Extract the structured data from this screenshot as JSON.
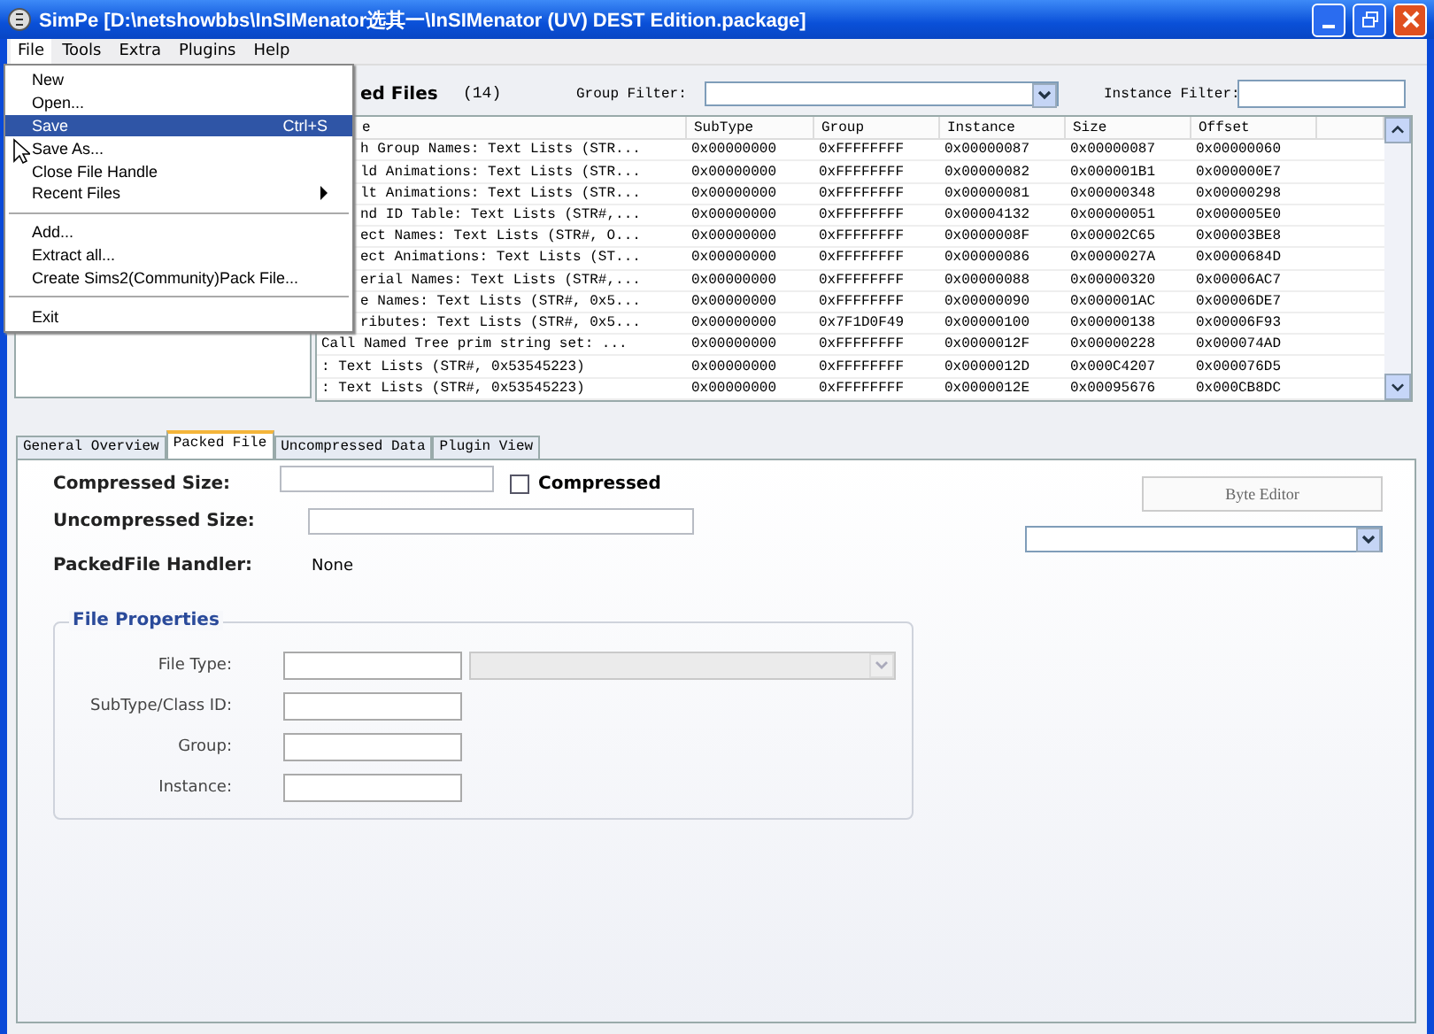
{
  "window": {
    "title": "SimPe [D:\\netshowbbs\\InSIMenator选其一\\InSIMenator (UV) DEST Edition.package]"
  },
  "menubar": [
    {
      "label": "File",
      "selected": true
    },
    {
      "label": "Tools",
      "selected": false
    },
    {
      "label": "Extra",
      "selected": false
    },
    {
      "label": "Plugins",
      "selected": false
    },
    {
      "label": "Help",
      "selected": false
    }
  ],
  "file_menu": [
    {
      "kind": "item",
      "label": "New",
      "selected": false
    },
    {
      "kind": "item",
      "label": "Open...",
      "selected": false
    },
    {
      "kind": "item",
      "label": "Save",
      "shortcut": "Ctrl+S",
      "selected": true
    },
    {
      "kind": "item",
      "label": "Save As...",
      "selected": false
    },
    {
      "kind": "item",
      "label": "Close File Handle",
      "selected": false
    },
    {
      "kind": "submenu",
      "label": "Recent Files",
      "selected": false
    },
    {
      "kind": "separator"
    },
    {
      "kind": "item",
      "label": "Add...",
      "selected": false
    },
    {
      "kind": "item",
      "label": "Extract all...",
      "selected": false
    },
    {
      "kind": "item",
      "label": "Create Sims2(Community)Pack File...",
      "selected": false
    },
    {
      "kind": "separator"
    },
    {
      "kind": "item",
      "label": "Exit",
      "selected": false
    }
  ],
  "files_panel": {
    "title": "ed Files",
    "count": "(14)",
    "group_filter_label": "Group Filter:",
    "instance_filter_label": "Instance Filter:"
  },
  "table": {
    "columns": [
      "e",
      "SubType",
      "Group",
      "Instance",
      "Size",
      "Offset"
    ],
    "rows": [
      [
        "h Group Names: Text Lists (STR...",
        "0x00000000",
        "0xFFFFFFFF",
        "0x00000087",
        "0x00000087",
        "0x00000060"
      ],
      [
        "ld Animations: Text Lists (STR...",
        "0x00000000",
        "0xFFFFFFFF",
        "0x00000082",
        "0x000001B1",
        "0x000000E7"
      ],
      [
        "lt Animations: Text Lists (STR...",
        "0x00000000",
        "0xFFFFFFFF",
        "0x00000081",
        "0x00000348",
        "0x00000298"
      ],
      [
        "nd ID Table: Text Lists (STR#,...",
        "0x00000000",
        "0xFFFFFFFF",
        "0x00004132",
        "0x00000051",
        "0x000005E0"
      ],
      [
        "ect Names: Text Lists (STR#, O...",
        "0x00000000",
        "0xFFFFFFFF",
        "0x0000008F",
        "0x00002C65",
        "0x00003BE8"
      ],
      [
        "ect Animations: Text Lists (ST...",
        "0x00000000",
        "0xFFFFFFFF",
        "0x00000086",
        "0x0000027A",
        "0x0000684D"
      ],
      [
        "erial Names: Text Lists (STR#,...",
        "0x00000000",
        "0xFFFFFFFF",
        "0x00000088",
        "0x00000320",
        "0x00006AC7"
      ],
      [
        "e Names: Text Lists (STR#, 0x5...",
        "0x00000000",
        "0xFFFFFFFF",
        "0x00000090",
        "0x000001AC",
        "0x00006DE7"
      ],
      [
        "ributes: Text Lists (STR#, 0x5...",
        "0x00000000",
        "0x7F1D0F49",
        "0x00000100",
        "0x00000138",
        "0x00006F93"
      ],
      [
        "Call Named Tree prim string set: ...",
        "0x00000000",
        "0xFFFFFFFF",
        "0x0000012F",
        "0x00000228",
        "0x000074AD"
      ],
      [
        ": Text Lists (STR#, 0x53545223)",
        "0x00000000",
        "0xFFFFFFFF",
        "0x0000012D",
        "0x000C4207",
        "0x000076D5"
      ],
      [
        ": Text Lists (STR#, 0x53545223)",
        "0x00000000",
        "0xFFFFFFFF",
        "0x0000012E",
        "0x00095676",
        "0x000CB8DC"
      ]
    ]
  },
  "tabs": [
    {
      "label": "General Overview",
      "selected": false
    },
    {
      "label": "Packed File",
      "selected": true
    },
    {
      "label": "Uncompressed Data",
      "selected": false
    },
    {
      "label": "Plugin View",
      "selected": false
    }
  ],
  "packed_file": {
    "compressed_size_label": "Compressed Size:",
    "compressed": {
      "label": "Compressed",
      "checked": false
    },
    "uncompressed_size_label": "Uncompressed Size:",
    "handler_label": "PackedFile Handler:",
    "handler": "None",
    "byte_editor_button": "Byte Editor",
    "file_properties": {
      "title": "File Properties",
      "fields": [
        {
          "label": "File Type:",
          "kind": "combo"
        },
        {
          "label": "SubType/Class ID:",
          "kind": "text"
        },
        {
          "label": "Group:",
          "kind": "text"
        },
        {
          "label": "Instance:",
          "kind": "text"
        }
      ]
    }
  }
}
